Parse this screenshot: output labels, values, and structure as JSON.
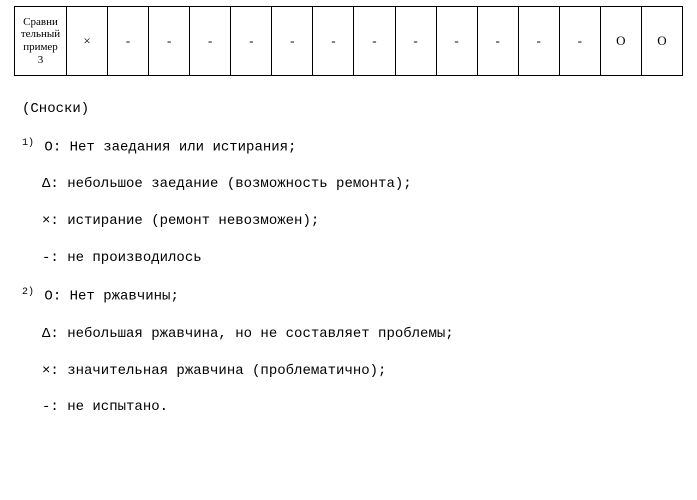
{
  "table": {
    "row_header": "Сравни\nтельный\nпример\n3",
    "cells": [
      "×",
      "-",
      "-",
      "-",
      "-",
      "-",
      "-",
      "-",
      "-",
      "-",
      "-",
      "-",
      "-",
      "O",
      "O"
    ]
  },
  "footnotes": {
    "heading": "(Сноски)",
    "group1": {
      "mark": "1)",
      "lines": [
        "O: Нет заедания или истирания;",
        "Δ: небольшое заедание (возможность ремонта);",
        "×: истирание (ремонт невозможен);",
        "-: не производилось"
      ]
    },
    "group2": {
      "mark": "2)",
      "lines": [
        "O: Нет ржавчины;",
        "Δ: небольшая ржавчина, но не составляет проблемы;",
        "×: значительная ржавчина (проблематично);",
        "-: не испытано."
      ]
    }
  }
}
